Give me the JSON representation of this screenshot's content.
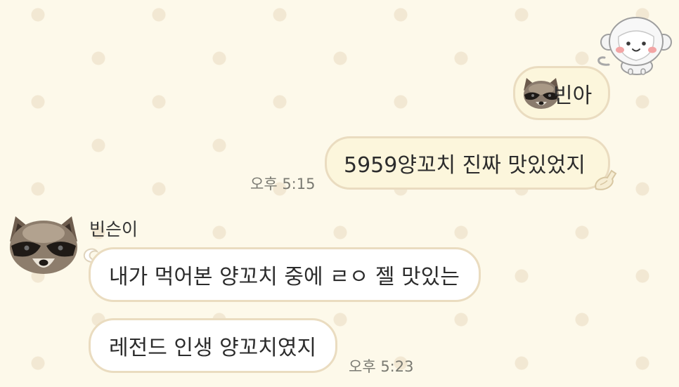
{
  "chat": {
    "messages_out": [
      {
        "text": "빈아"
      },
      {
        "text": "5959양꼬치 진짜 맛있었지",
        "time": "오후 5:15"
      }
    ],
    "sender": {
      "name": "빈슨이"
    },
    "messages_in": [
      {
        "text": "내가 먹어본 양꼬치 중에 ㄹㅇ 젤 맛있는"
      },
      {
        "text": "레전드 인생 양꼬치였지",
        "time": "오후 5:23"
      }
    ]
  },
  "colors": {
    "background": "#fdf9ea",
    "dot": "#f2e8d3",
    "outgoing_bubble": "#fcf6dc",
    "incoming_bubble": "#ffffff",
    "bubble_border": "#eadcc0"
  },
  "icons": [
    "monkey-sticker-icon",
    "raccoon-emoji-icon",
    "raccoon-avatar-icon"
  ]
}
